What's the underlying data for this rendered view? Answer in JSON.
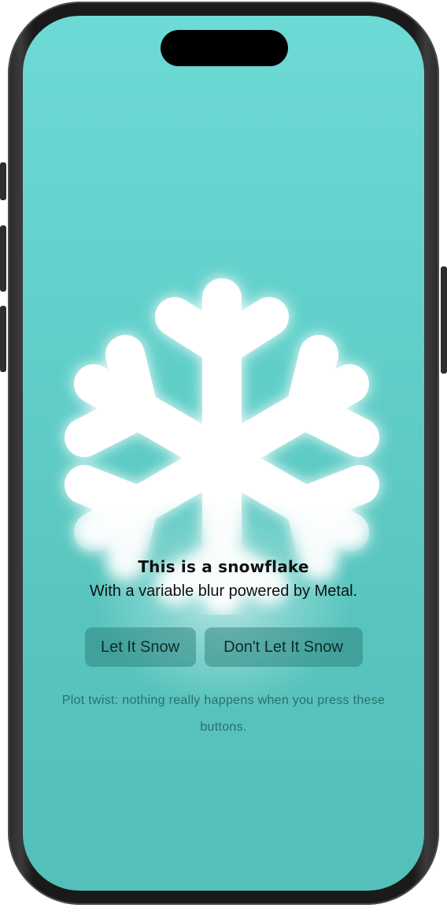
{
  "colors": {
    "screen_top": "#6ddad5",
    "screen_bottom": "#55bfb9",
    "button_fill": "#2f8a83",
    "text_primary": "#111111",
    "text_muted": "#2a6f6a",
    "snowflake": "#ffffff"
  },
  "hero": {
    "icon": "snowflake-icon"
  },
  "content": {
    "title": "This is a snowflake",
    "subtitle": "With a variable blur powered by Metal.",
    "note": "Plot twist: nothing really happens when you press these buttons."
  },
  "buttons": {
    "let_it_snow": "Let It Snow",
    "dont_let_it_snow": "Don't Let It Snow"
  }
}
